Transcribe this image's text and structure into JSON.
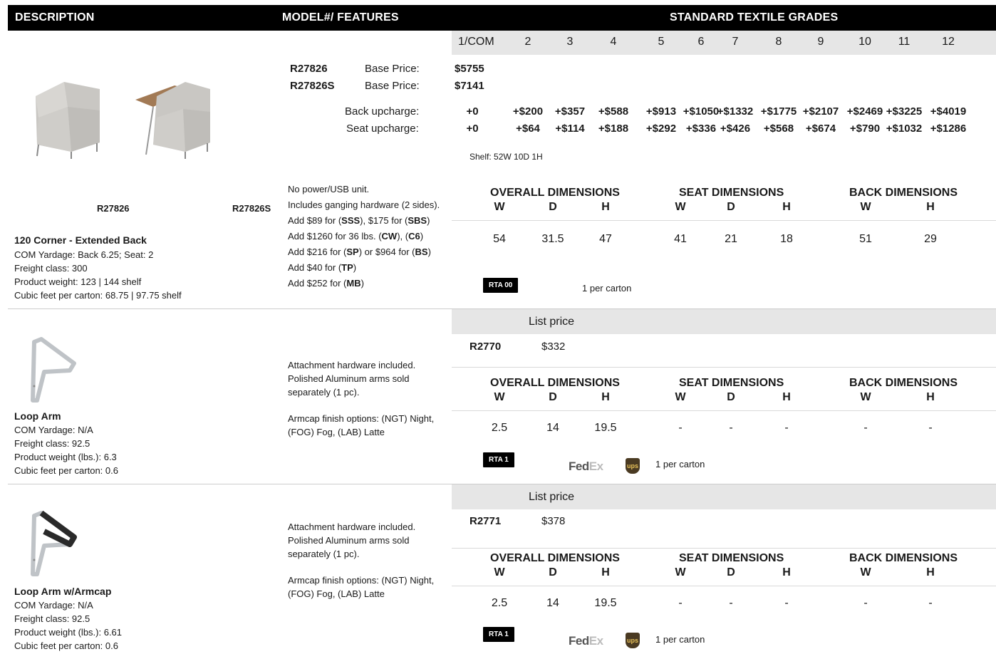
{
  "header": {
    "description": "DESCRIPTION",
    "model": "MODEL#/ FEATURES",
    "grades": "STANDARD TEXTILE GRADES"
  },
  "grade_labels": [
    "1/COM",
    "2",
    "3",
    "4",
    "5",
    "6",
    "7",
    "8",
    "9",
    "10",
    "11",
    "12"
  ],
  "dims_headings": {
    "overall": "OVERALL DIMENSIONS",
    "seat": "SEAT DIMENSIONS",
    "back": "BACK DIMENSIONS"
  },
  "dims_letters": {
    "w": "W",
    "d": "D",
    "h": "H"
  },
  "product1": {
    "img_label_a": "R27826",
    "img_label_b": "R27826S",
    "title": "120 Corner - Extended Back",
    "specs": [
      "COM Yardage: Back 6.25; Seat: 2",
      "Freight class: 300",
      "Product weight: 123 | 144 shelf",
      "Cubic feet per carton: 68.75 | 97.75 shelf"
    ],
    "models": [
      {
        "model": "R27826",
        "label": "Base Price:",
        "price": "$5755"
      },
      {
        "model": "R27826S",
        "label": "Base Price:",
        "price": "$7141"
      }
    ],
    "back_upcharge_label": "Back upcharge:",
    "seat_upcharge_label": "Seat upcharge:",
    "back_upcharges": [
      "+0",
      "+$200",
      "+$357",
      "+$588",
      "+$913",
      "+$1050",
      "+$1332",
      "+$1775",
      "+$2107",
      "+$2469",
      "+$3225",
      "+$4019"
    ],
    "seat_upcharges": [
      "+0",
      "+$64",
      "+$114",
      "+$188",
      "+$292",
      "+$336",
      "+$426",
      "+$568",
      "+$674",
      "+$790",
      "+$1032",
      "+$1286"
    ],
    "shelf": "Shelf: 52W  10D  1H",
    "features": [
      "No power/USB unit.",
      "Includes ganging hardware (2 sides).",
      "Add $89 for (SSS), $175 for (SBS)",
      "Add $1260 for 36 lbs. (CW), (C6)",
      "Add $216 for (SP) or $964 for (BS)",
      "Add $40 for (TP)",
      "Add $252 for (MB)"
    ],
    "dims": {
      "ow": "54",
      "od": "31.5",
      "oh": "47",
      "sw": "41",
      "sd": "21",
      "sh": "18",
      "bw": "51",
      "bh": "29"
    },
    "rta": "RTA 00",
    "carton": "1 per carton"
  },
  "product2": {
    "title": "Loop Arm",
    "specs": [
      "COM Yardage: N/A",
      "Freight class: 92.5",
      "Product weight (lbs.): 6.3",
      "Cubic feet per carton: 0.6"
    ],
    "list_price_label": "List price",
    "model": "R2770",
    "price": "$332",
    "features_a": [
      "Attachment hardware included.",
      "Polished Aluminum arms sold",
      "separately (1 pc)."
    ],
    "features_b": [
      "Armcap finish options: (NGT) Night,",
      "(FOG) Fog, (LAB) Latte"
    ],
    "dims": {
      "ow": "2.5",
      "od": "14",
      "oh": "19.5",
      "sw": "-",
      "sd": "-",
      "sh": "-",
      "bw": "-",
      "bh": "-"
    },
    "rta": "RTA 1",
    "fedex_a": "Fed",
    "fedex_b": "Ex",
    "ups": "ups",
    "carton": "1 per carton"
  },
  "product3": {
    "title": "Loop Arm w/Armcap",
    "specs": [
      "COM Yardage: N/A",
      "Freight class: 92.5",
      "Product weight (lbs.): 6.61",
      "Cubic feet per carton: 0.6"
    ],
    "list_price_label": "List price",
    "model": "R2771",
    "price": "$378",
    "features_a": [
      "Attachment hardware included.",
      "Polished Aluminum arms sold",
      "separately (1 pc)."
    ],
    "features_b": [
      "Armcap finish options: (NGT) Night,",
      "(FOG) Fog, (LAB) Latte"
    ],
    "dims": {
      "ow": "2.5",
      "od": "14",
      "oh": "19.5",
      "sw": "-",
      "sd": "-",
      "sh": "-",
      "bw": "-",
      "bh": "-"
    },
    "rta": "RTA 1",
    "fedex_a": "Fed",
    "fedex_b": "Ex",
    "ups": "ups",
    "carton": "1 per carton"
  }
}
